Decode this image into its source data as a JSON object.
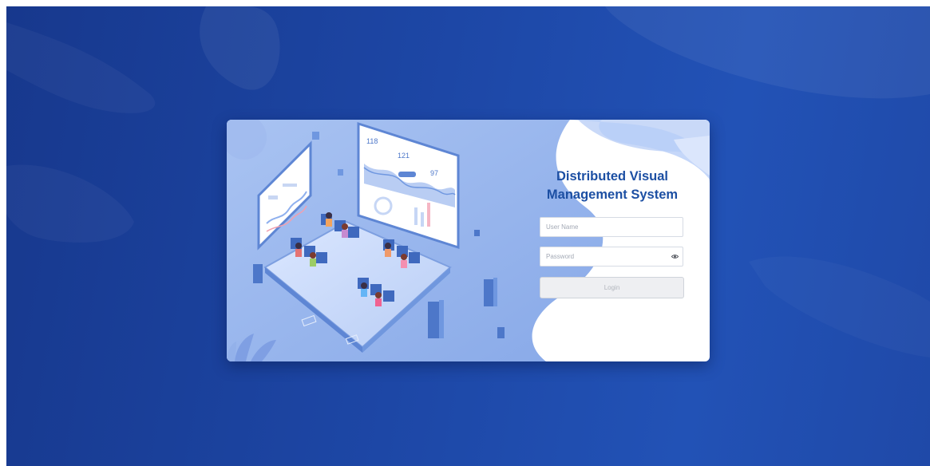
{
  "colors": {
    "background_dark": "#17388d",
    "background_light": "#2252b6",
    "title": "#1c4fa3",
    "illustration_blue": "#6f97e0",
    "button_bg": "#eeeff2"
  },
  "app": {
    "title_line1": "Distributed Visual",
    "title_line2": "Management System"
  },
  "form": {
    "username_placeholder": "User Name",
    "password_placeholder": "Password",
    "login_label": "Login"
  },
  "illustration": {
    "stat_1": "118",
    "stat_2": "121",
    "stat_3": "97"
  },
  "icons": {
    "password_toggle": "eye-icon"
  }
}
